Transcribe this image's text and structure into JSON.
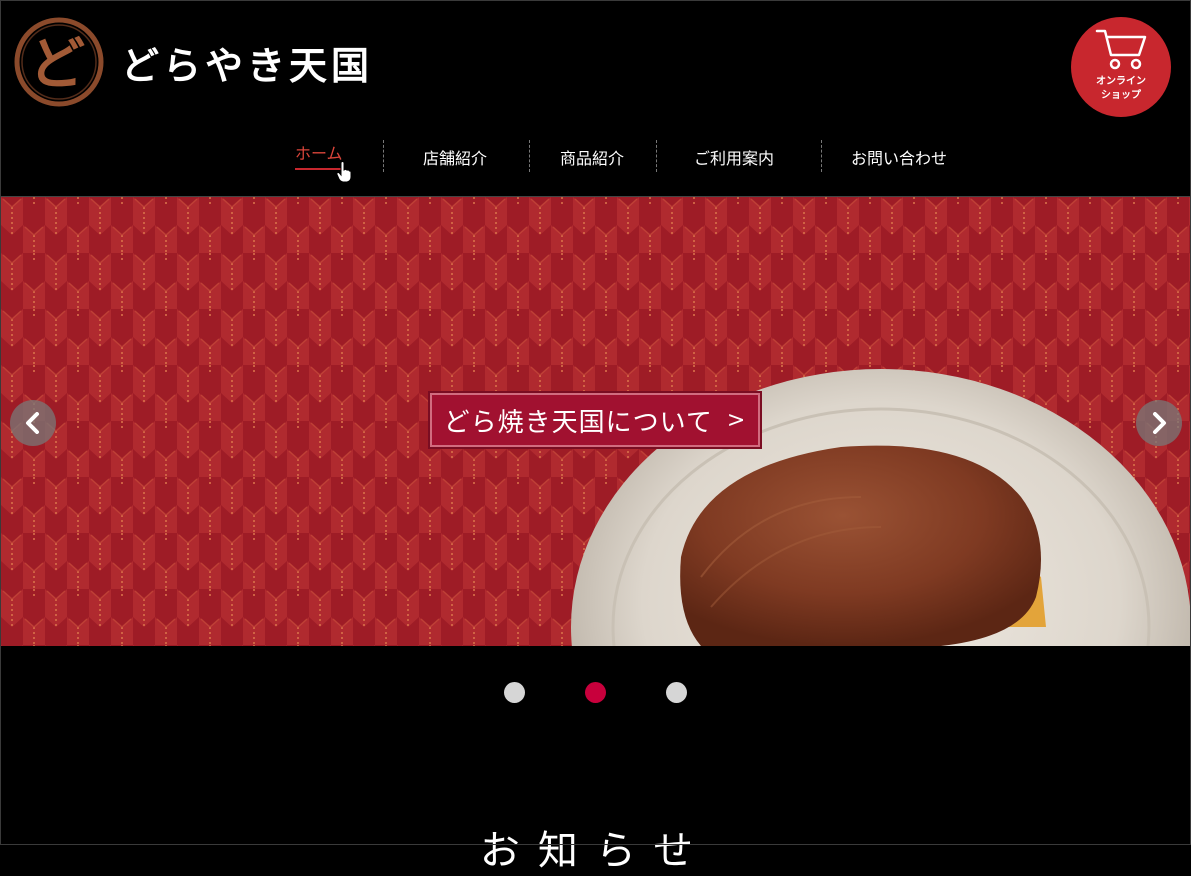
{
  "brand": {
    "logo_char": "ど",
    "name": "どらやき天国"
  },
  "cart": {
    "label_line1": "オンライン",
    "label_line2": "ショップ",
    "icon": "shopping-cart-icon"
  },
  "nav": {
    "items": [
      {
        "label": "ホーム",
        "active": true
      },
      {
        "label": "店舗紹介",
        "active": false
      },
      {
        "label": "商品紹介",
        "active": false
      },
      {
        "label": "ご利用案内",
        "active": false
      },
      {
        "label": "お問い合わせ",
        "active": false
      }
    ]
  },
  "hero": {
    "cta_label": "どら焼き天国について",
    "cta_arrow": ">",
    "prev_icon": "chevron-left-icon",
    "next_icon": "chevron-right-icon",
    "slide_count": 3,
    "active_slide": 2
  },
  "news": {
    "title": "お知らせ"
  },
  "colors": {
    "accent": "#c8272e",
    "cta": "#a11130",
    "active_dot": "#c8003c",
    "background": "#000000"
  }
}
